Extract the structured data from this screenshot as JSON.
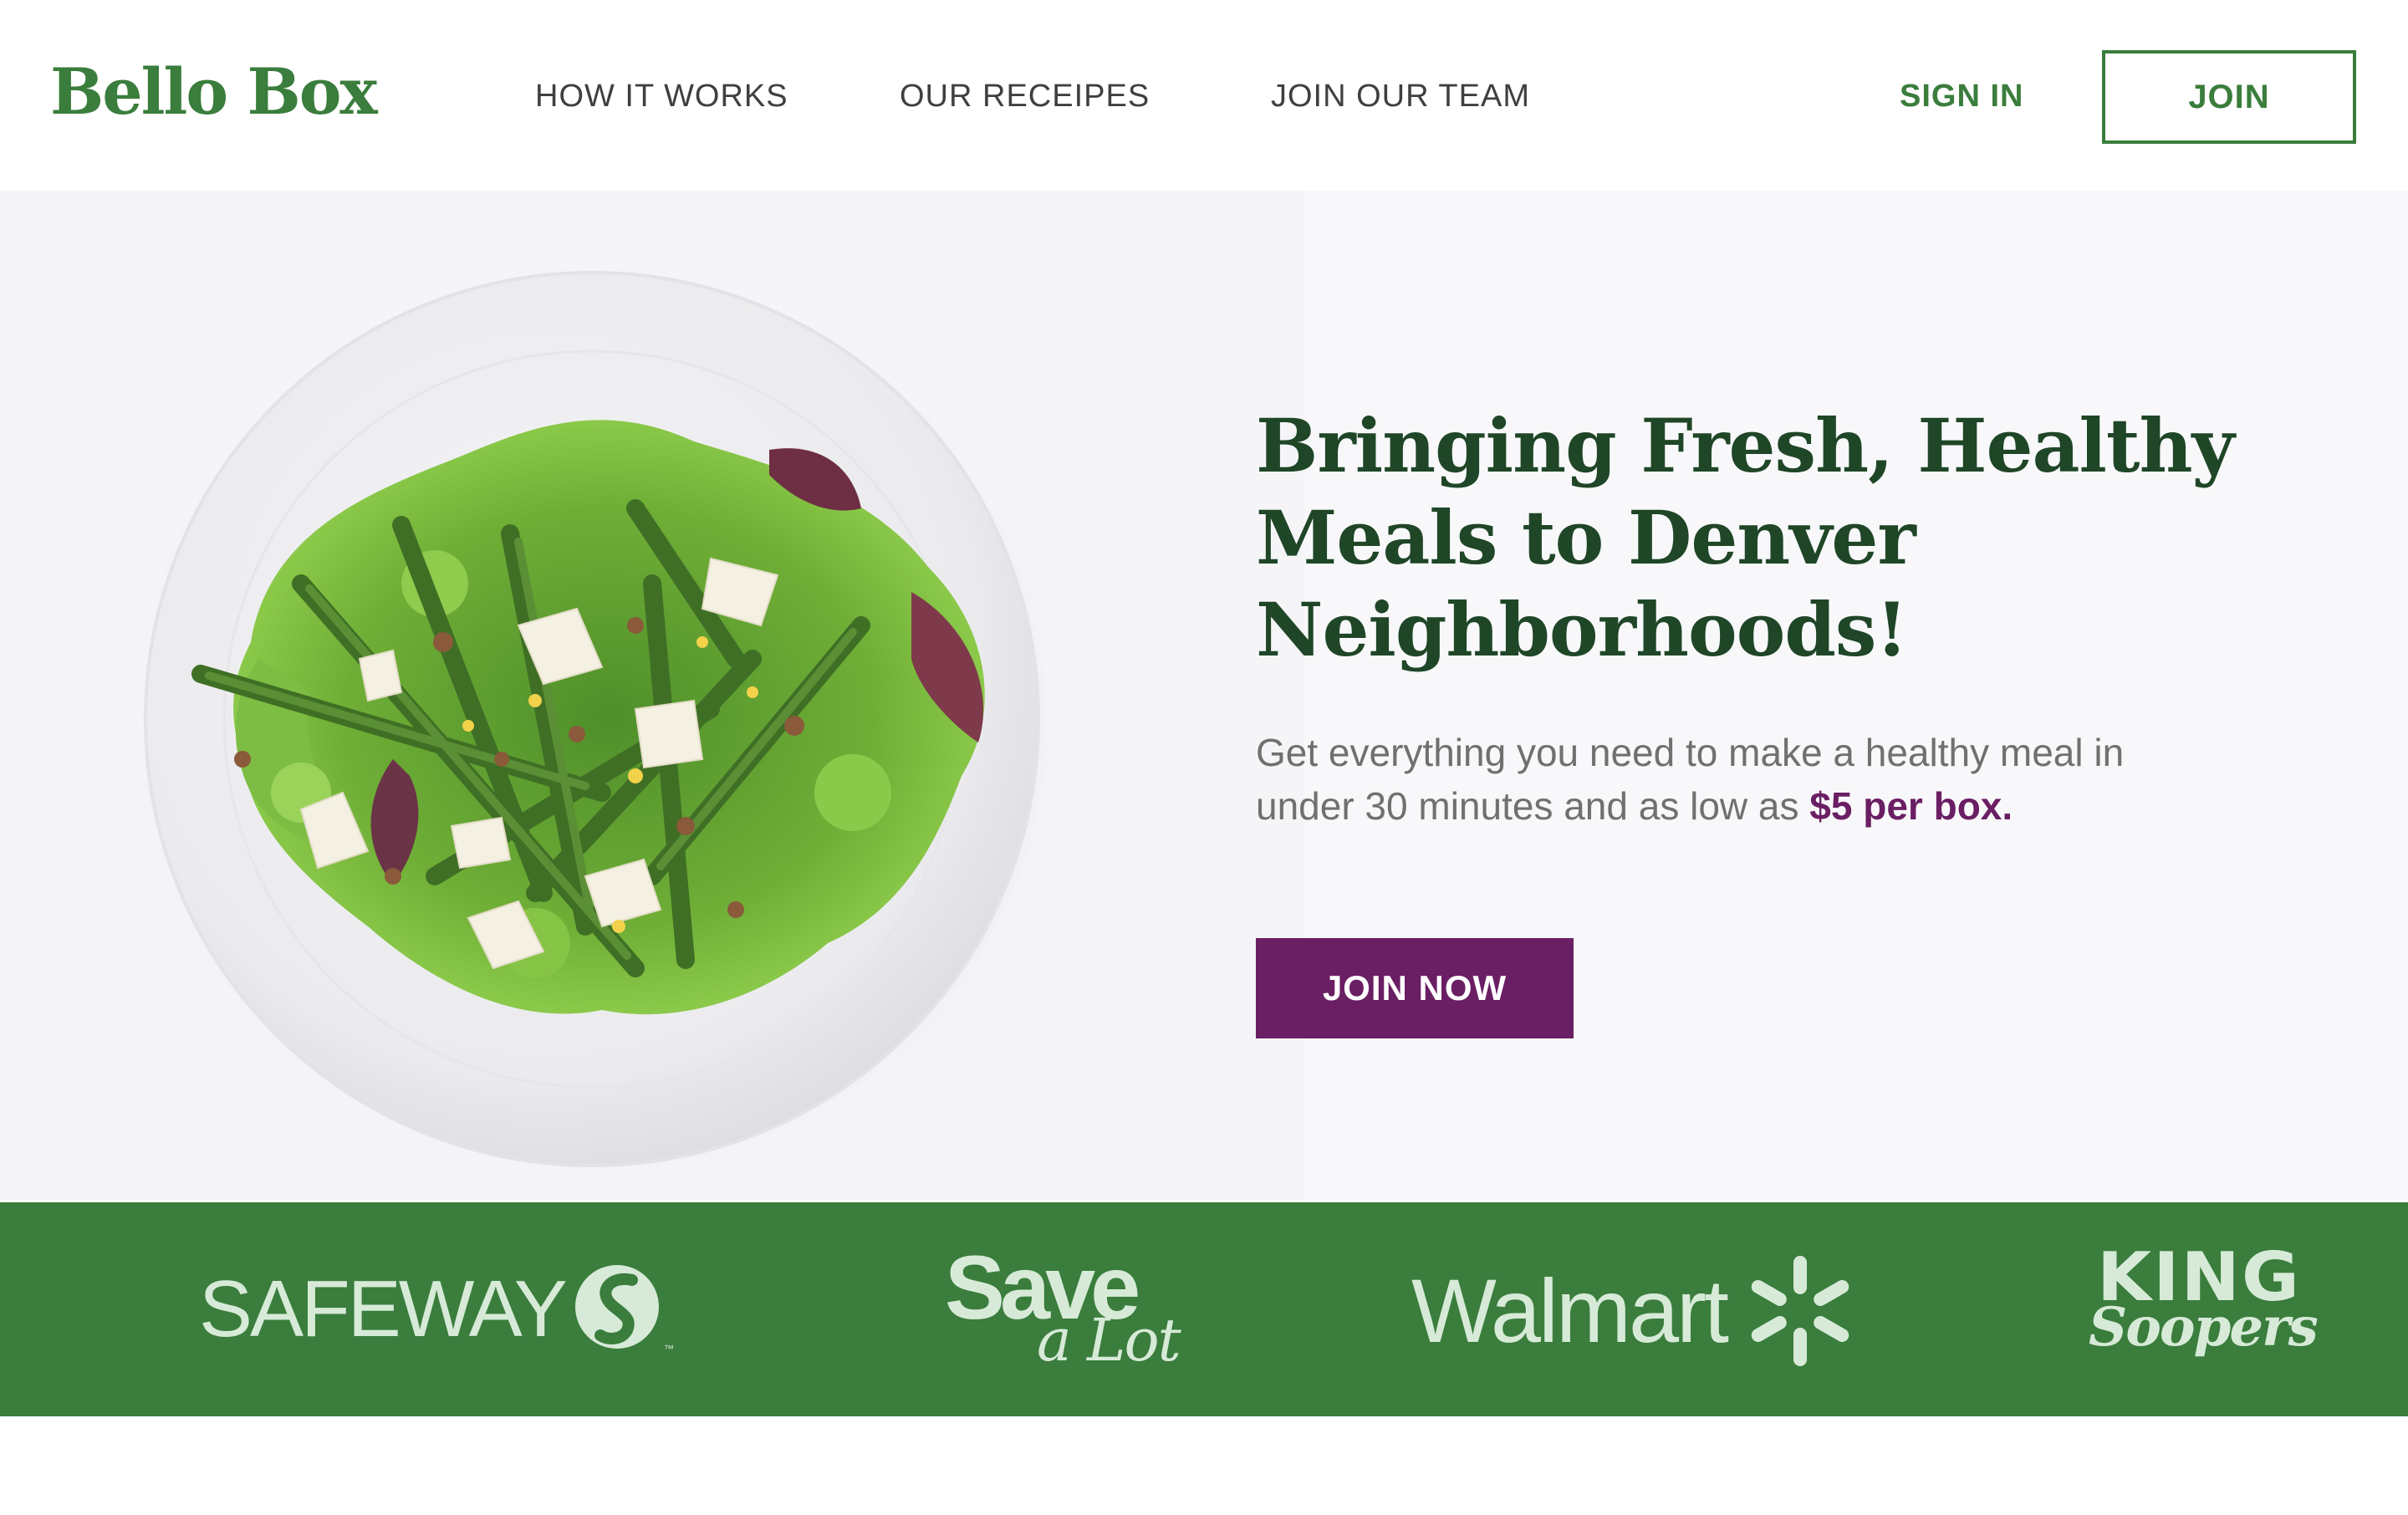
{
  "brand": {
    "logo_text": "Bello Box",
    "primary_color": "#3a7d3c",
    "accent_color": "#6a1e63",
    "headline_color": "#1f4627"
  },
  "nav": {
    "items": [
      {
        "label": "HOW IT WORKS"
      },
      {
        "label": "OUR RECEIPES"
      },
      {
        "label": "JOIN OUR TEAM"
      }
    ],
    "sign_in": "SIGN IN",
    "join": "JOIN"
  },
  "hero": {
    "image_icon": "salad-plate-photo",
    "headline": "Bringing Fresh, Healthy Meals to Denver Neighborhoods!",
    "subtext": "Get everything you need to make a healthy meal in under 30 minutes and as low as ",
    "price_highlight": "$5 per box.",
    "cta": "JOIN NOW"
  },
  "partners": {
    "background": "#3a7d3c",
    "safeway": {
      "text": "SAFEWAY",
      "trademark": "™"
    },
    "savealot": {
      "text": "Save",
      "script": "a Lot"
    },
    "walmart": {
      "text": "Walmart"
    },
    "kingsoopers": {
      "text": "KING",
      "script": "Soopers"
    }
  }
}
